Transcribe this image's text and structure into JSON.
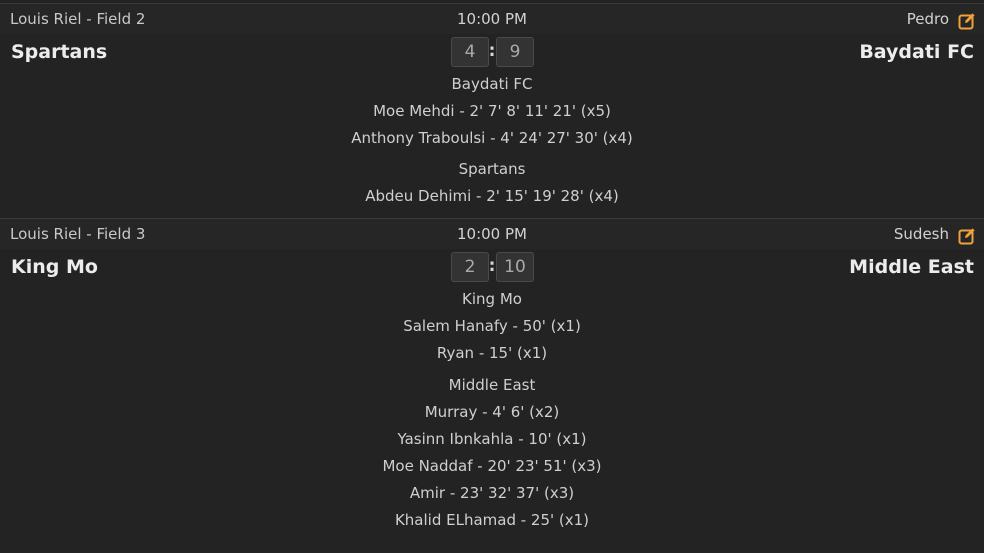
{
  "colors": {
    "background": "#232323",
    "accent_edit": "#f0a23a",
    "text": "#d6d6d6"
  },
  "matches": [
    {
      "field": "Louis Riel - Field 2",
      "time": "10:00 PM",
      "referee": "Pedro",
      "home_team": "Spartans",
      "away_team": "Baydati FC",
      "home_score": "4",
      "away_score": "9",
      "separator": ":",
      "groups": [
        {
          "team": "Baydati FC",
          "scorers": [
            "Moe Mehdi - 2' 7' 8' 11' 21' (x5)",
            "Anthony Traboulsi - 4' 24' 27' 30' (x4)"
          ]
        },
        {
          "team": "Spartans",
          "scorers": [
            "Abdeu Dehimi - 2' 15' 19' 28' (x4)"
          ]
        }
      ]
    },
    {
      "field": "Louis Riel - Field 3",
      "time": "10:00 PM",
      "referee": "Sudesh",
      "home_team": "King Mo",
      "away_team": "Middle East",
      "home_score": "2",
      "away_score": "10",
      "separator": ":",
      "groups": [
        {
          "team": "King Mo",
          "scorers": [
            "Salem Hanafy - 50' (x1)",
            "Ryan - 15' (x1)"
          ]
        },
        {
          "team": "Middle East",
          "scorers": [
            "Murray - 4' 6' (x2)",
            "Yasinn Ibnkahla - 10' (x1)",
            "Moe Naddaf - 20' 23' 51' (x3)",
            "Amir - 23' 32' 37' (x3)",
            "Khalid ELhamad - 25' (x1)"
          ]
        }
      ]
    }
  ]
}
